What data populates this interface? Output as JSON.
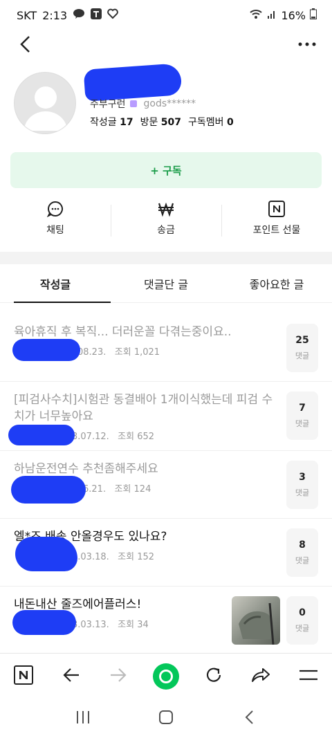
{
  "status": {
    "carrier": "SKT",
    "time": "2:13",
    "battery": "16%"
  },
  "profile": {
    "nickname": "주부구런",
    "user_id": "gods******",
    "stats": [
      {
        "label": "작성글",
        "value": "17"
      },
      {
        "label": "방문",
        "value": "507"
      },
      {
        "label": "구독멤버",
        "value": "0"
      }
    ]
  },
  "subscribe": {
    "label": "+ 구독"
  },
  "actions": [
    {
      "label": "채팅",
      "icon": "chat-icon"
    },
    {
      "label": "송금",
      "icon": "won-icon"
    },
    {
      "label": "포인트 선물",
      "icon": "naver-n-icon"
    }
  ],
  "tabs": [
    {
      "label": "작성글",
      "active": true
    },
    {
      "label": "댓글단 글",
      "active": false
    },
    {
      "label": "좋아요한 글",
      "active": false
    }
  ],
  "posts": [
    {
      "title": "육아휴직 후 복직... 더러운꼴 다겪는중이요..",
      "date": "08.23.",
      "views": "조회 1,021",
      "comments": "25",
      "comment_label": "댓글",
      "read": true
    },
    {
      "title": "[피검사수치]시험관 동결배아 1개이식했는데 피검 수치가 너무높아요",
      "date": "3.07.12.",
      "views": "조회 652",
      "comments": "7",
      "comment_label": "댓글",
      "read": true
    },
    {
      "title": "하남운전연수 추천좀해주세요",
      "date": "6.21.",
      "views": "조회 124",
      "comments": "3",
      "comment_label": "댓글",
      "read": true
    },
    {
      "title": "엘*즈 배송 안올경우도 있나요?",
      "date": "3.03.18.",
      "views": "조회 152",
      "comments": "8",
      "comment_label": "댓글",
      "read": false
    },
    {
      "title": "내돈내산 줄즈에어플러스!",
      "date": "3.03.13.",
      "views": "조회 34",
      "comments": "0",
      "comment_label": "댓글",
      "read": false
    }
  ],
  "colors": {
    "accent": "#03c75a",
    "subscribe_bg": "#e6f8ec",
    "subscribe_text": "#1a9c48",
    "redaction": "#1e3df5"
  }
}
